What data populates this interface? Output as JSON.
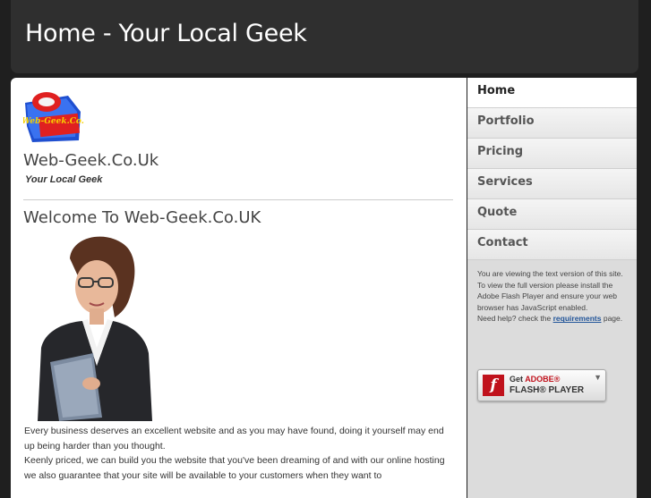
{
  "header": {
    "title": "Home - Your Local Geek"
  },
  "main": {
    "logo_text": "Web-Geek.Co.Uk",
    "site_name": "Web-Geek.Co.Uk",
    "slogan": "Your Local Geek",
    "welcome_heading": "Welcome To Web-Geek.Co.UK",
    "paragraphs": [
      "Every business deserves an excellent website and as you may have found, doing it yourself may end up being harder than you thought.",
      "Keenly priced, we can build you the website that you've been dreaming of and with our online hosting we also guarantee that your site will be available to your customers when they want to"
    ]
  },
  "sidebar": {
    "nav": [
      {
        "label": "Home",
        "active": true
      },
      {
        "label": "Portfolio"
      },
      {
        "label": "Pricing"
      },
      {
        "label": "Services"
      },
      {
        "label": "Quote"
      },
      {
        "label": "Contact"
      }
    ],
    "notice": {
      "line1": "You are viewing the text version of this site.",
      "line2": "To view the full version please install the Adobe Flash Player and ensure your web browser has JavaScript enabled.",
      "help_prefix": "Need help? check the",
      "help_link": "requirements",
      "help_suffix": "page."
    },
    "flash_button": {
      "get": "Get",
      "adobe": "ADOBE®",
      "player": "FLASH® PLAYER",
      "icon_letter": "f"
    }
  },
  "colors": {
    "page_bg": "#1f1f1f",
    "header_bg": "#2f2f2f",
    "sidebar_bg": "#dcdcdc",
    "flash_red": "#c0121c"
  }
}
